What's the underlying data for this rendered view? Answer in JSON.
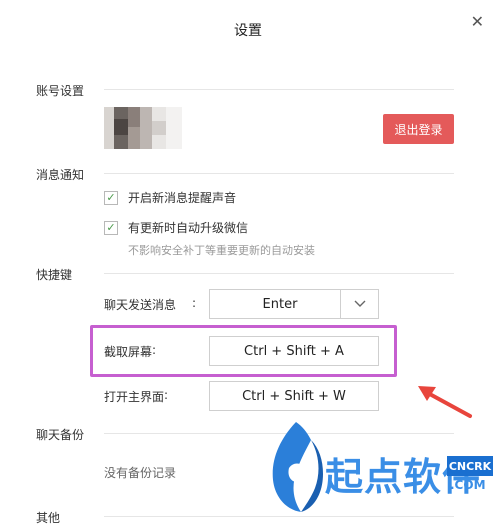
{
  "window": {
    "title": "设置"
  },
  "sections": {
    "account": "账号设置",
    "notifications": "消息通知",
    "shortcuts": "快捷键",
    "backup": "聊天备份",
    "other": "其他"
  },
  "account": {
    "logout_label": "退出登录"
  },
  "notifications": {
    "items": [
      {
        "label": "开启新消息提醒声音",
        "checked": true
      },
      {
        "label": "有更新时自动升级微信",
        "checked": true
      }
    ],
    "hint": "不影响安全补丁等重要更新的自动安装"
  },
  "shortcuts": {
    "send": {
      "label": "聊天发送消息",
      "value": "Enter"
    },
    "screenshot": {
      "label": "截取屏幕",
      "value": "Ctrl + Shift + A"
    },
    "open_main": {
      "label": "打开主界面",
      "value": "Ctrl + Shift + W"
    }
  },
  "backup": {
    "empty_text": "没有备份记录"
  },
  "watermark": {
    "brand": "起点软件",
    "badge": "CNCRK",
    "domain": ".COM"
  },
  "colors": {
    "logout": "#e45a5a",
    "highlight": "#c65fd0",
    "arrow": "#e8453c",
    "check": "#4a9a4a"
  }
}
